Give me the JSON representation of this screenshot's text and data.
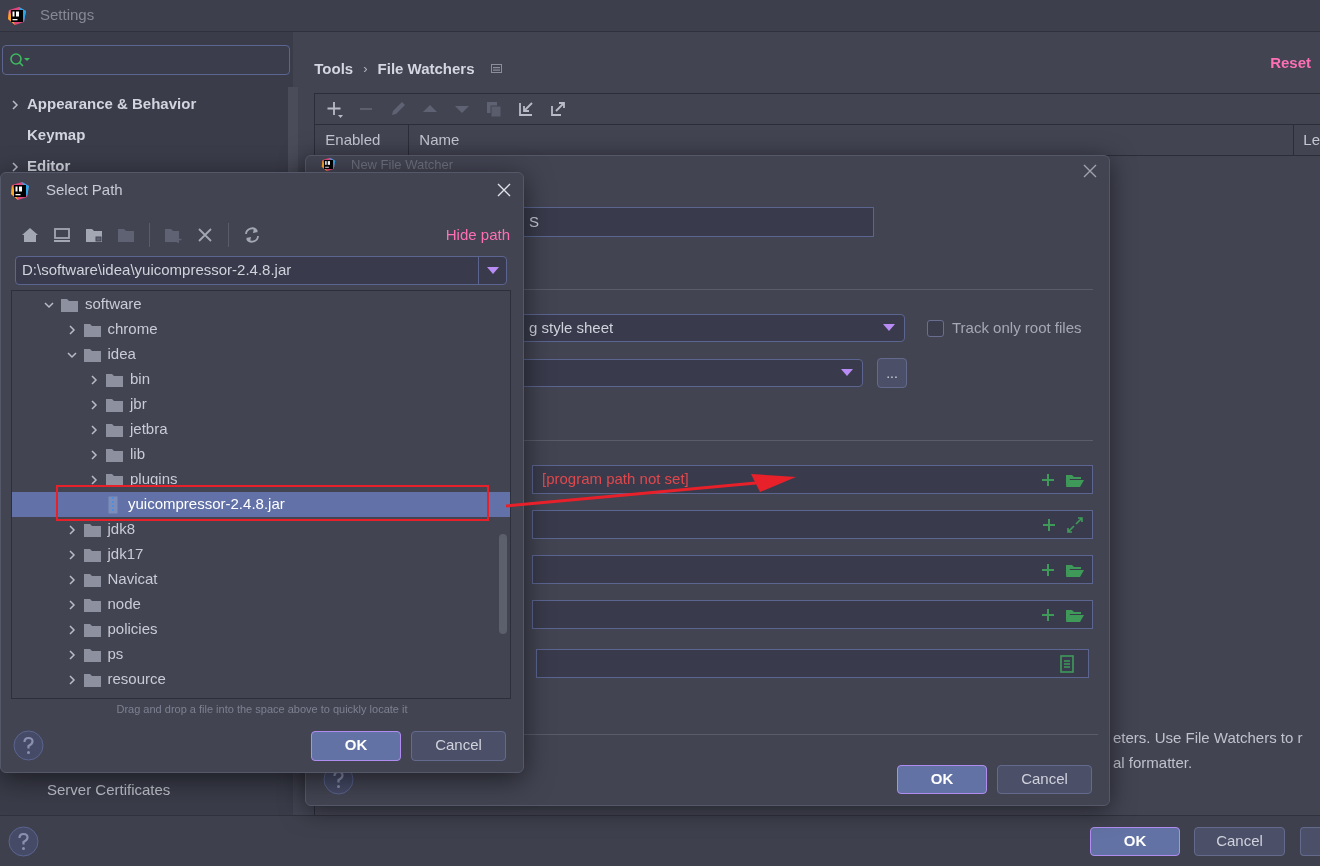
{
  "window": {
    "title": "Settings"
  },
  "sidebar": {
    "items": [
      {
        "label": "Appearance & Behavior",
        "kind": "group",
        "expanded": false
      },
      {
        "label": "Keymap",
        "kind": "leaf"
      },
      {
        "label": "Editor",
        "kind": "group",
        "expanded": false
      },
      {
        "label": "Server Certificates",
        "kind": "nested"
      }
    ]
  },
  "breadcrumb": [
    "Tools",
    "File Watchers"
  ],
  "breadcrumb_separator": "›",
  "reset": "Reset",
  "table": {
    "columns": [
      "Enabled",
      "Name",
      "Le"
    ]
  },
  "description": [
    "eters. Use File Watchers to r",
    "al formatter."
  ],
  "buttons": [
    "OK",
    "Cancel"
  ],
  "file_watcher_dialog": {
    "title": "New File Watcher",
    "name_value": "S",
    "file_type_value": "g style sheet",
    "track_only_root_files": {
      "label": "Track only root files",
      "checked": false
    },
    "scope_button": "...",
    "fields": [
      {
        "kind": "path",
        "placeholder": "[program path not set]"
      },
      {
        "kind": "expand"
      },
      {
        "kind": "path"
      },
      {
        "kind": "path"
      },
      {
        "kind": "env"
      }
    ],
    "buttons": [
      "OK",
      "Cancel"
    ]
  },
  "select_path_dialog": {
    "title": "Select Path",
    "hide_path": "Hide path",
    "path_value": "D:\\software\\idea\\yuicompressor-2.4.8.jar",
    "tree": [
      {
        "label": "software",
        "kind": "folder",
        "expanded": true,
        "selected": false,
        "children": [
          {
            "label": "chrome",
            "kind": "folder",
            "expanded": false,
            "selected": false
          },
          {
            "label": "idea",
            "kind": "folder",
            "expanded": true,
            "selected": false,
            "children": [
              {
                "label": "bin",
                "kind": "folder",
                "expanded": false,
                "selected": false
              },
              {
                "label": "jbr",
                "kind": "folder",
                "expanded": false,
                "selected": false
              },
              {
                "label": "jetbra",
                "kind": "folder",
                "expanded": false,
                "selected": false
              },
              {
                "label": "lib",
                "kind": "folder",
                "expanded": false,
                "selected": false
              },
              {
                "label": "plugins",
                "kind": "folder",
                "expanded": false,
                "selected": false
              },
              {
                "label": "yuicompressor-2.4.8.jar",
                "kind": "file",
                "selected": true
              }
            ]
          },
          {
            "label": "jdk8",
            "kind": "folder",
            "expanded": false,
            "selected": false
          },
          {
            "label": "jdk17",
            "kind": "folder",
            "expanded": false,
            "selected": false
          },
          {
            "label": "Navicat",
            "kind": "folder",
            "expanded": false,
            "selected": false
          },
          {
            "label": "node",
            "kind": "folder",
            "expanded": false,
            "selected": false
          },
          {
            "label": "policies",
            "kind": "folder",
            "expanded": false,
            "selected": false
          },
          {
            "label": "ps",
            "kind": "folder",
            "expanded": false,
            "selected": false
          },
          {
            "label": "resource",
            "kind": "folder",
            "expanded": false,
            "selected": false
          }
        ]
      }
    ],
    "hint": "Drag and drop a file into the space above to quickly locate it",
    "buttons": [
      "OK",
      "Cancel"
    ]
  }
}
